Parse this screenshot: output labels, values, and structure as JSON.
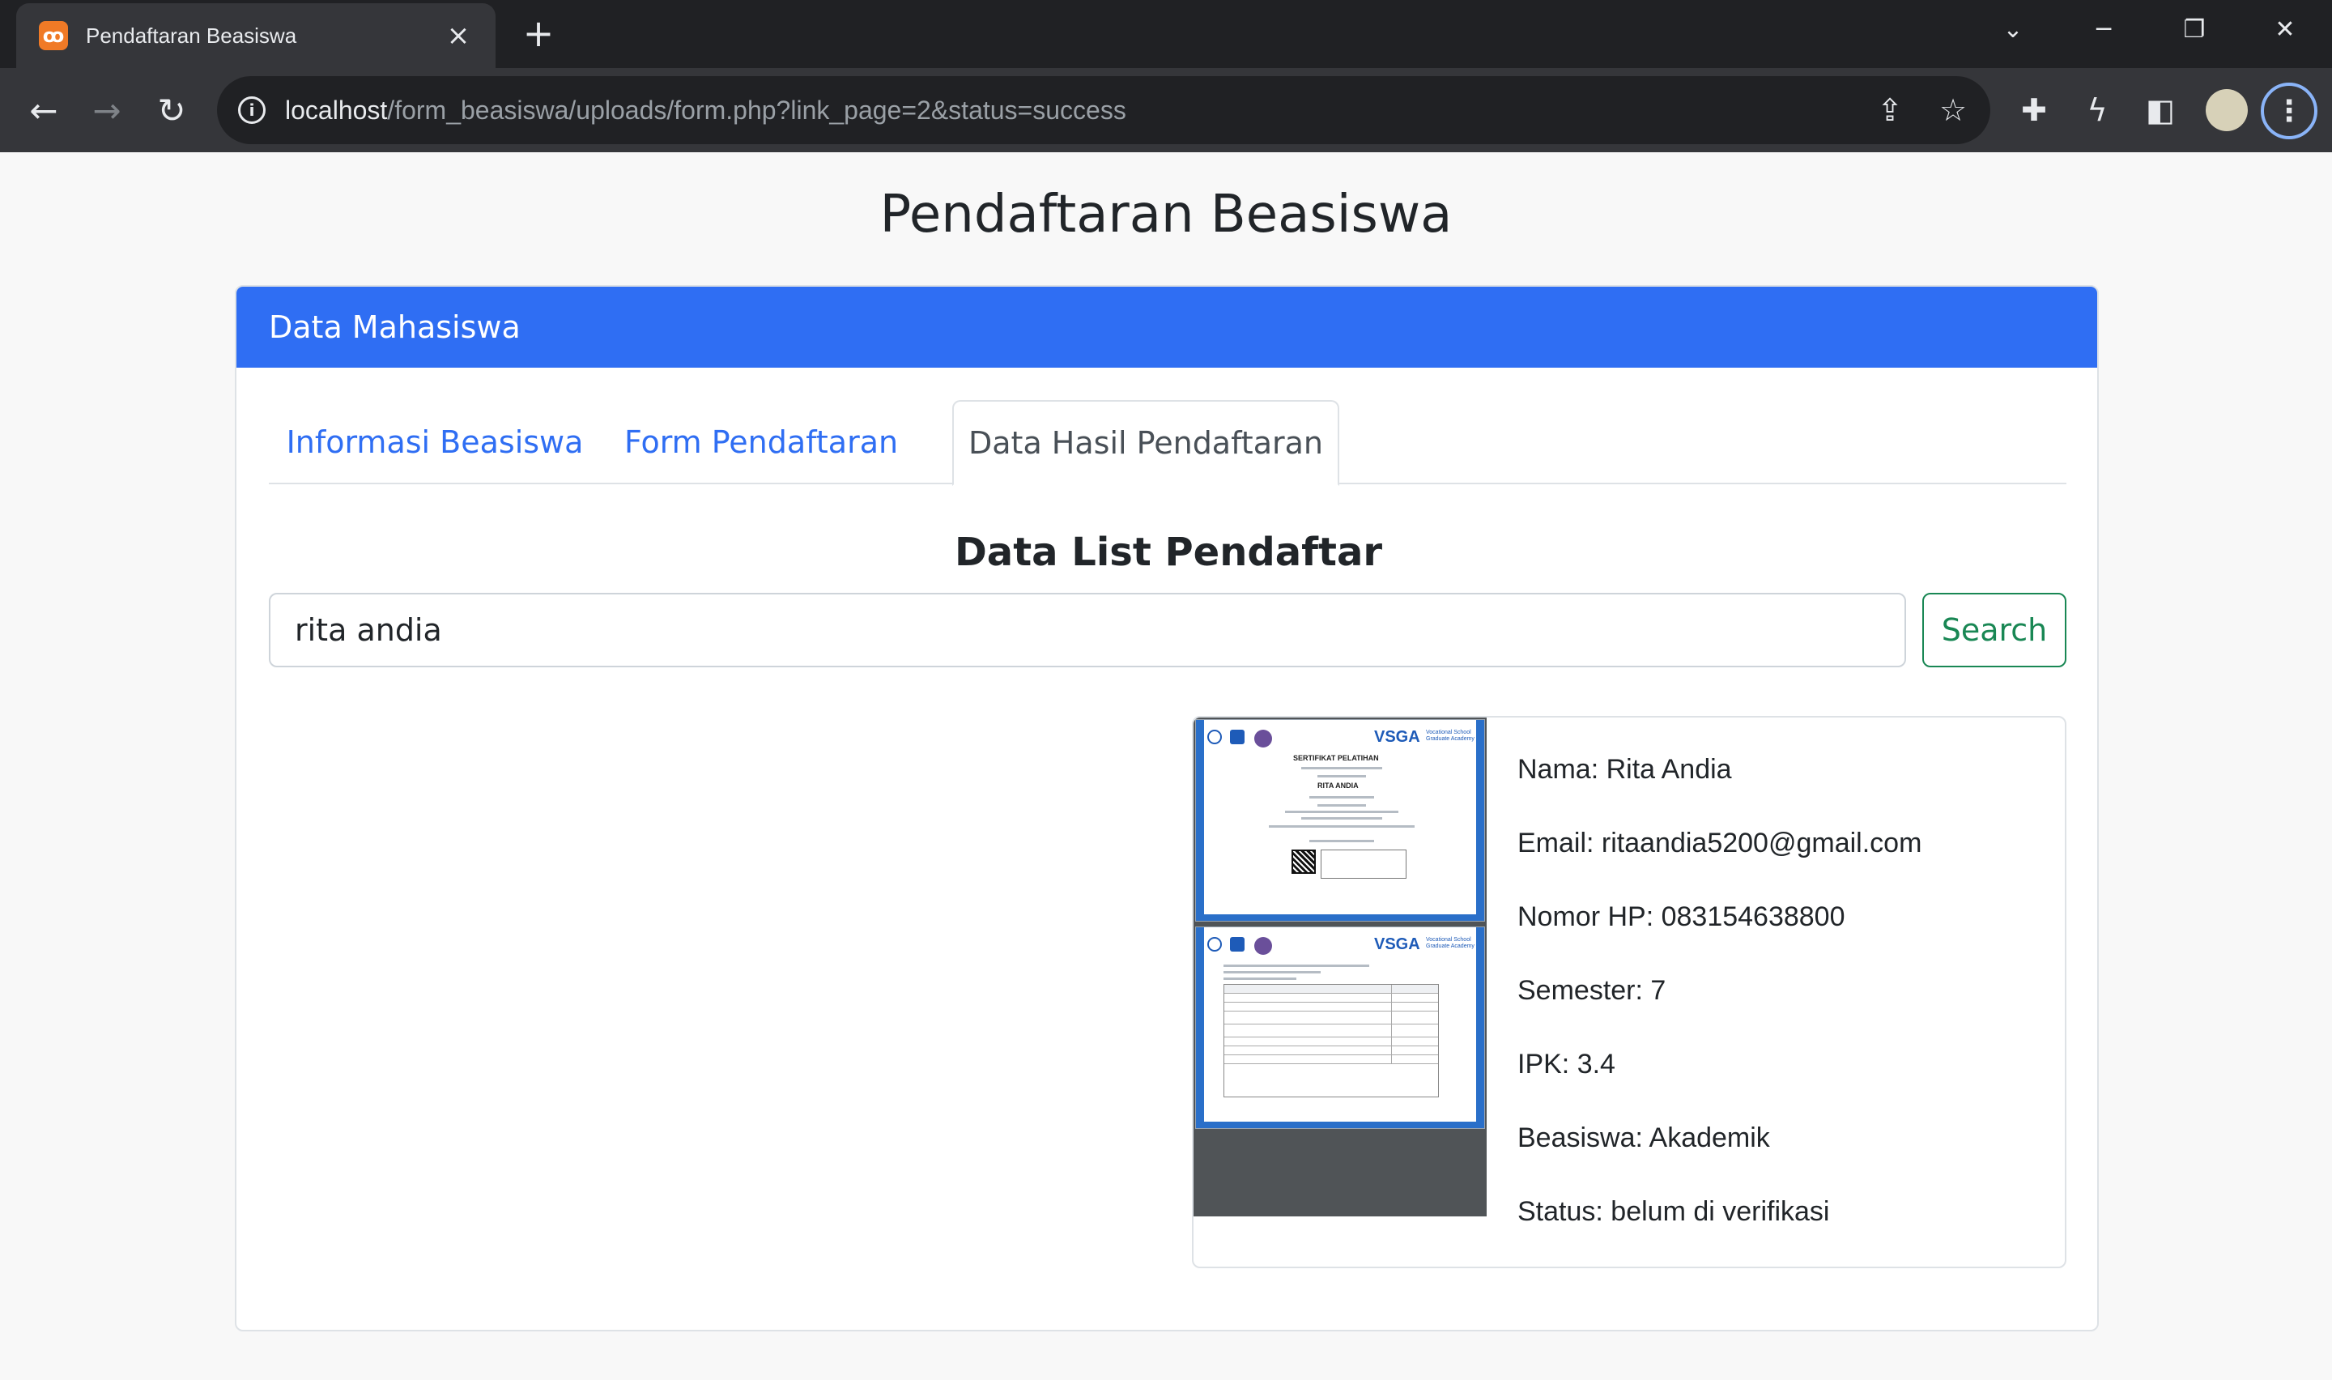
{
  "browser": {
    "tab_title": "Pendaftaran Beasiswa",
    "tab_favicon": "xampp-icon",
    "url_host": "localhost",
    "url_path": "/form_beasiswa/uploads/form.php?link_page=2&status=success"
  },
  "page": {
    "title": "Pendaftaran Beasiswa",
    "card_header": "Data Mahasiswa",
    "tabs": [
      {
        "label": "Informasi Beasiswa",
        "active": false
      },
      {
        "label": "Form Pendaftaran",
        "active": false
      },
      {
        "label": "Data Hasil Pendaftaran",
        "active": true
      }
    ],
    "section_title": "Data List Pendaftar",
    "search": {
      "value": "rita andia",
      "button_label": "Search"
    },
    "result": {
      "nama": "Nama: Rita Andia",
      "email": "Email: ritaandia5200@gmail.com",
      "hp": "Nomor HP: 083154638800",
      "semester": "Semester: 7",
      "ipk": "IPK: 3.4",
      "beasiswa": "Beasiswa: Akademik",
      "status": "Status: belum di verifikasi"
    },
    "document": {
      "logo": "VSGA",
      "cert_title": "SERTIFIKAT PELATIHAN",
      "cert_name": "RITA ANDIA"
    }
  },
  "colors": {
    "primary": "#2f6ef3",
    "success": "#198754",
    "chrome_dark": "#202124",
    "chrome_toolbar": "#35363a"
  }
}
